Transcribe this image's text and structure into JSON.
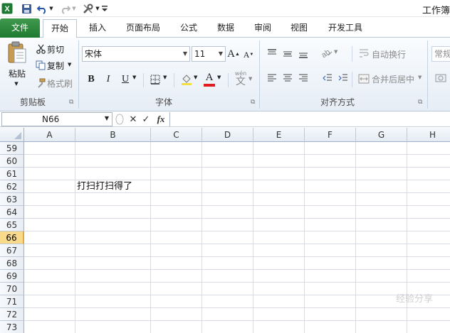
{
  "title_bar": {
    "title": "工作簿",
    "qat_icons": [
      "excel-logo-icon",
      "save-icon",
      "undo-icon",
      "redo-icon",
      "tools-icon",
      "customize-qat-icon"
    ]
  },
  "tabs": [
    {
      "label": "文件",
      "active": false,
      "variant": "file"
    },
    {
      "label": "开始",
      "active": true
    },
    {
      "label": "插入",
      "active": false
    },
    {
      "label": "页面布局",
      "active": false
    },
    {
      "label": "公式",
      "active": false
    },
    {
      "label": "数据",
      "active": false
    },
    {
      "label": "审阅",
      "active": false
    },
    {
      "label": "视图",
      "active": false
    },
    {
      "label": "开发工具",
      "active": false
    }
  ],
  "ribbon": {
    "clipboard": {
      "paste_label": "粘贴",
      "cut_label": "剪切",
      "copy_label": "复制",
      "format_painter_label": "格式刷",
      "group_label": "剪贴板"
    },
    "font": {
      "font_name": "宋体",
      "font_size": "11",
      "bold": "B",
      "italic": "I",
      "underline": "U",
      "font_color_glyph": "A",
      "grow_font": "A",
      "shrink_font": "A",
      "phonetic": "wén",
      "phonetic_char": "文",
      "group_label": "字体",
      "font_color": "#e11b1b"
    },
    "alignment": {
      "wrap_text_label": "自动换行",
      "merge_center_label": "合并后居中",
      "group_label": "对齐方式"
    },
    "number": {
      "format_label": "常规"
    }
  },
  "formula_bar": {
    "name_box": "N66",
    "fx_label": "fx",
    "formula": ""
  },
  "sheet": {
    "columns": [
      "A",
      "B",
      "C",
      "D",
      "E",
      "F",
      "G",
      "H"
    ],
    "rows": [
      "59",
      "60",
      "61",
      "62",
      "63",
      "64",
      "65",
      "66",
      "67",
      "68",
      "69",
      "70",
      "71",
      "72",
      "73"
    ],
    "selected_row": "66",
    "cell_B62": "打扫打扫得了"
  },
  "watermark": "经验分享"
}
